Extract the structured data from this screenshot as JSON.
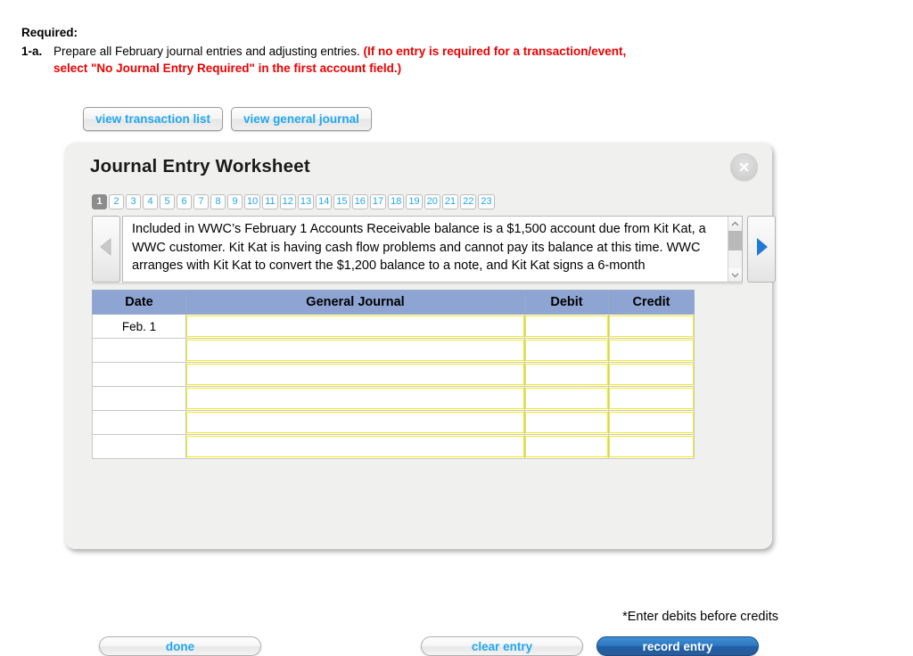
{
  "required": {
    "heading": "Required:",
    "item_number": "1-a.",
    "item_text": "Prepare all February journal entries and adjusting entries.",
    "item_text_red": "(If no entry is required for a transaction/event, select \"No Journal Entry Required\" in the first account field.)",
    "red_color": "#ee0000"
  },
  "view_buttons": {
    "transaction_list": "view transaction list",
    "general_journal": "view general journal",
    "link_color": "#22a7f0"
  },
  "dialog": {
    "title": "Journal Entry Worksheet",
    "close_icon": "close-x-icon",
    "tabs": [
      "1",
      "2",
      "3",
      "4",
      "5",
      "6",
      "7",
      "8",
      "9",
      "10",
      "11",
      "12",
      "13",
      "14",
      "15",
      "16",
      "17",
      "18",
      "19",
      "20",
      "21",
      "22",
      "23"
    ],
    "active_tab": "1",
    "active_tab_bg": "#8c8c8c",
    "prev_icon": "triangle-left-icon",
    "next_icon": "triangle-right-icon",
    "prev_enabled": false,
    "next_enabled": true,
    "transaction_text": "Included in WWC’s February 1 Accounts Receivable balance is a $1,500 account due from Kit Kat, a WWC customer. Kit Kat is having cash flow problems and cannot pay its balance at this time. WWC arranges with Kit Kat to convert the $1,200 balance to a note, and Kit Kat signs a 6-month",
    "scrollbar_up_icon": "chevron-up-icon",
    "scrollbar_down_icon": "chevron-down-icon"
  },
  "table": {
    "headers": [
      "Date",
      "General Journal",
      "Debit",
      "Credit"
    ],
    "header_bg": "#8ea4d2",
    "input_border": "#f2eb18",
    "rows": [
      {
        "date": "Feb. 1",
        "journal": "",
        "debit": "",
        "credit": ""
      },
      {
        "date": "",
        "journal": "",
        "debit": "",
        "credit": ""
      },
      {
        "date": "",
        "journal": "",
        "debit": "",
        "credit": ""
      },
      {
        "date": "",
        "journal": "",
        "debit": "",
        "credit": ""
      },
      {
        "date": "",
        "journal": "",
        "debit": "",
        "credit": ""
      },
      {
        "date": "",
        "journal": "",
        "debit": "",
        "credit": ""
      }
    ],
    "note": "*Enter debits before credits"
  },
  "footer": {
    "done": "done",
    "clear_entry": "clear entry",
    "record_entry": "record entry",
    "record_entry_bg": "#2f79c2"
  }
}
